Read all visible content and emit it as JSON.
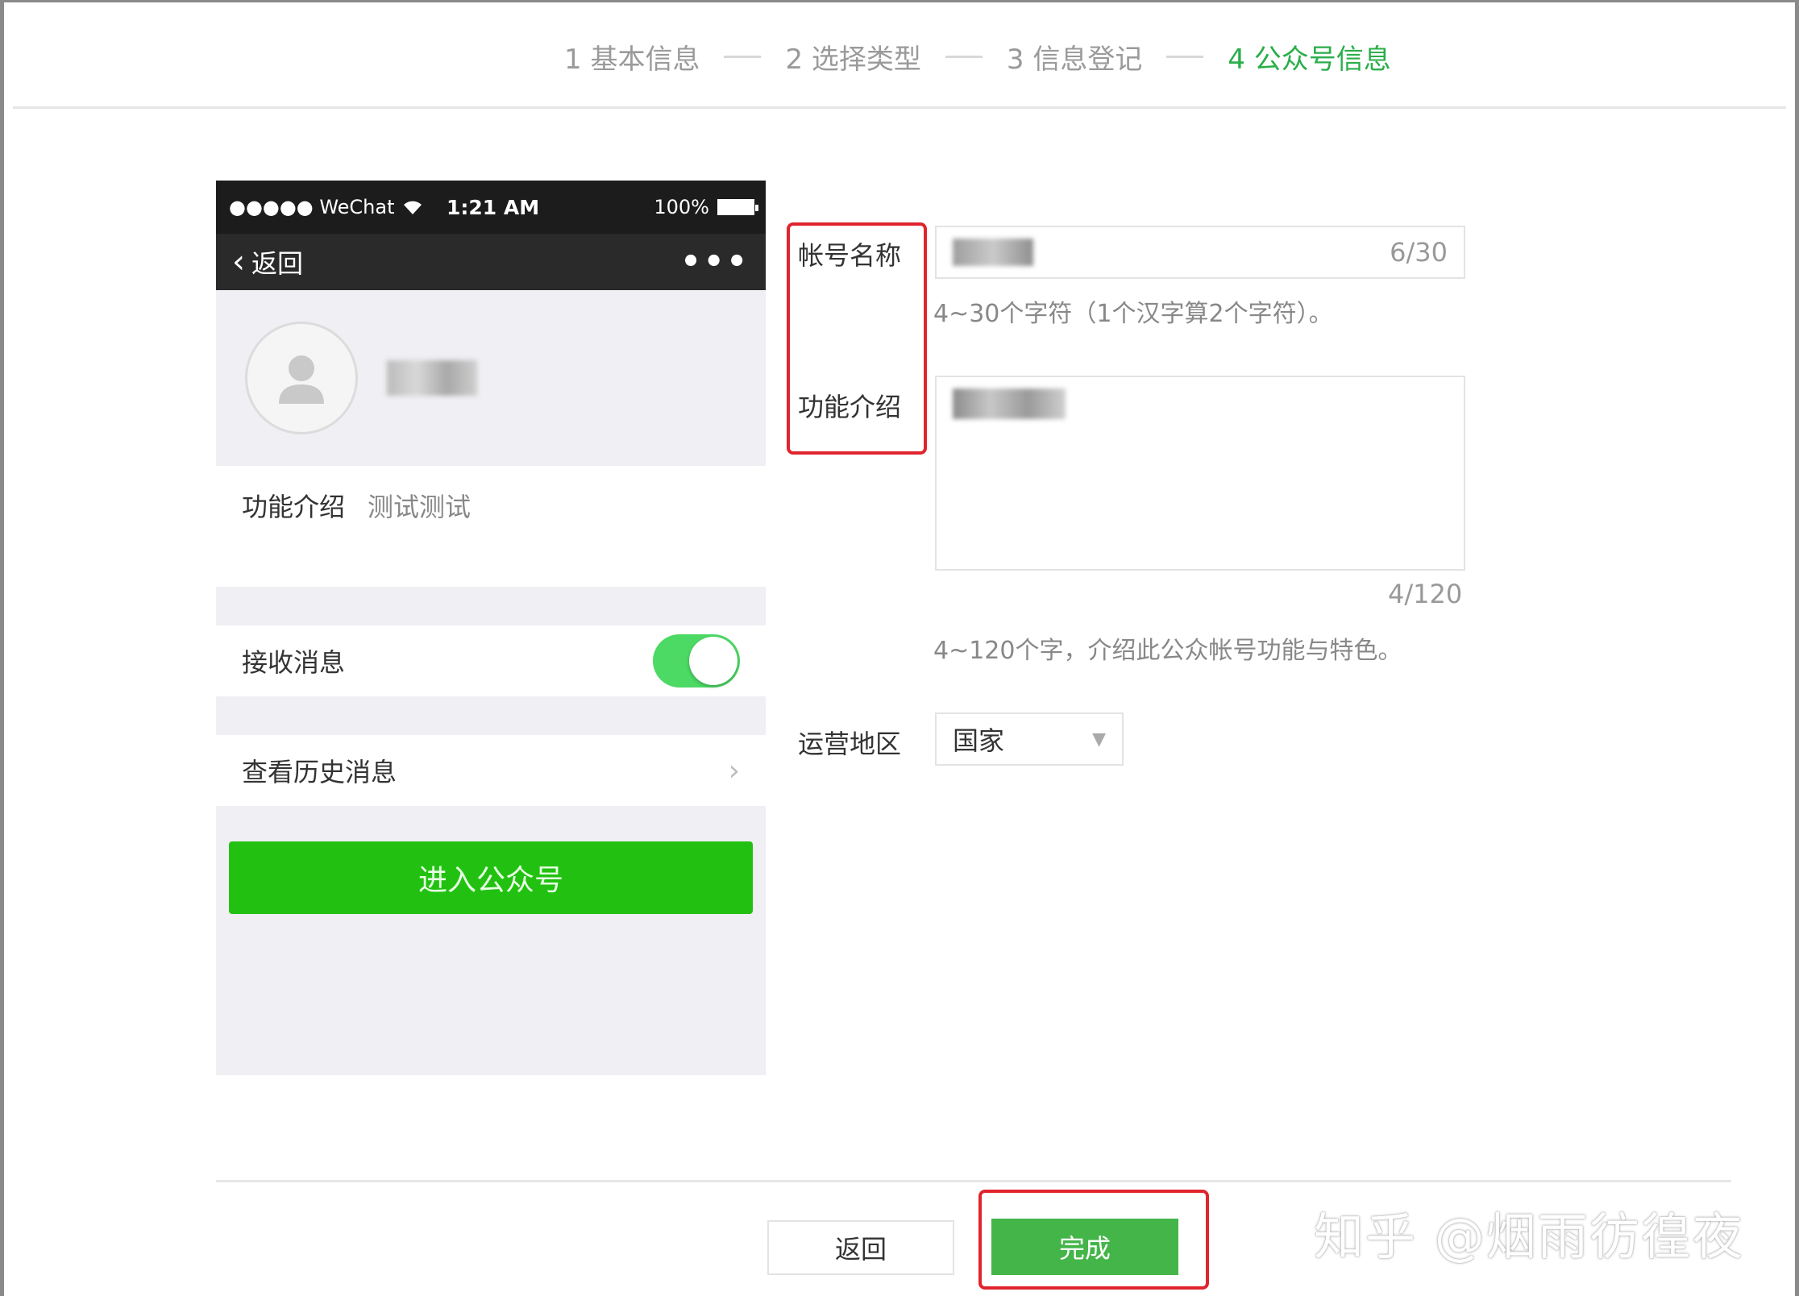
{
  "steps": [
    {
      "label": "1 基本信息"
    },
    {
      "label": "2 选择类型"
    },
    {
      "label": "3 信息登记"
    },
    {
      "label": "4 公众号信息"
    }
  ],
  "phone": {
    "carrier": "●●●●● WeChat",
    "time": "1:21 AM",
    "battery": "100%",
    "back_label": "返回",
    "more": "•••",
    "intro_label": "功能介绍",
    "intro_value": "测试测试",
    "receive_label": "接收消息",
    "receive_on": true,
    "history_label": "查看历史消息",
    "enter_button": "进入公众号"
  },
  "form": {
    "name_label": "帐号名称",
    "name_counter": "6/30",
    "name_hint": "4~30个字符（1个汉字算2个字符）。",
    "desc_label": "功能介绍",
    "desc_counter": "4/120",
    "desc_hint": "4~120个字，介绍此公众帐号功能与特色。",
    "region_label": "运营地区",
    "region_value": "国家"
  },
  "footer": {
    "back_button": "返回",
    "done_button": "完成"
  },
  "watermark": "知乎 @烟雨彷徨夜",
  "colors": {
    "accent": "#2aae4a",
    "enter_button": "#22c111",
    "done_button": "#44b549",
    "highlight": "#e0242d"
  }
}
